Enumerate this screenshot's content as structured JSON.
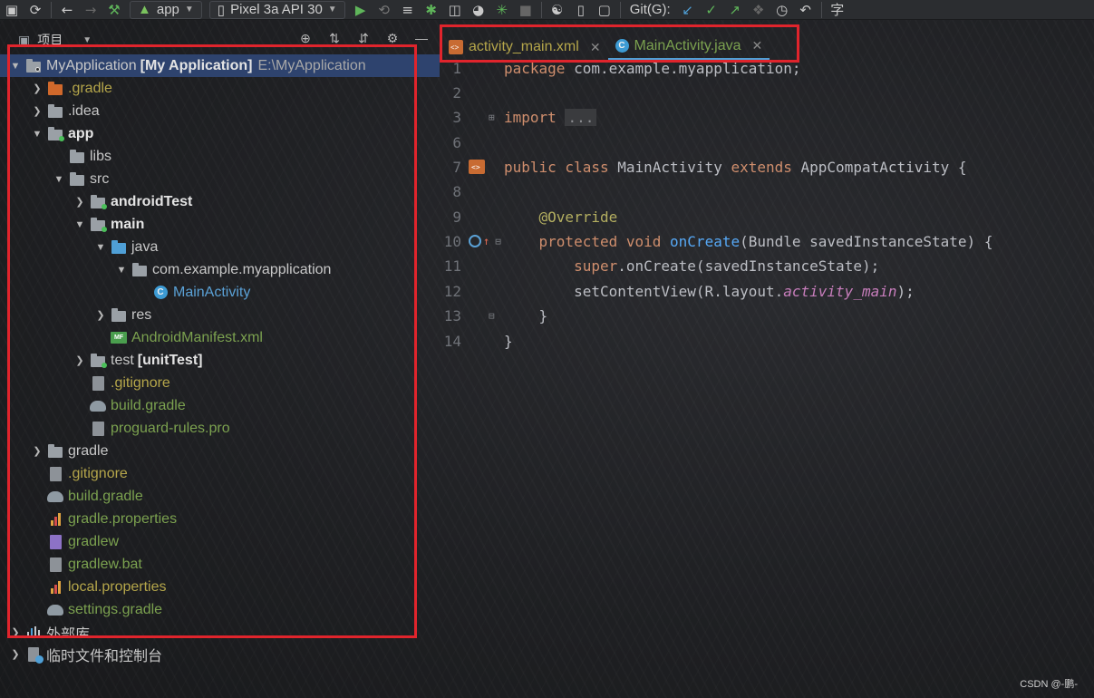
{
  "toolbar": {
    "run_config": "app",
    "device": "Pixel 3a API 30",
    "git_label": "Git(G):"
  },
  "project_panel": {
    "title": "项目",
    "tree": [
      {
        "name": "MyApplication",
        "module": "[My Application]",
        "path": "E:\\MyApplication"
      },
      {
        "label": ".gradle"
      },
      {
        "label": ".idea"
      },
      {
        "label": "app"
      },
      {
        "label": "libs"
      },
      {
        "label": "src"
      },
      {
        "label": "androidTest"
      },
      {
        "label": "main"
      },
      {
        "label": "java"
      },
      {
        "label": "com.example.myapplication"
      },
      {
        "label": "MainActivity"
      },
      {
        "label": "res"
      },
      {
        "label": "AndroidManifest.xml"
      },
      {
        "label": "test",
        "suffix": "[unitTest]"
      },
      {
        "label": ".gitignore"
      },
      {
        "label": "build.gradle"
      },
      {
        "label": "proguard-rules.pro"
      },
      {
        "label": "gradle"
      },
      {
        "label": ".gitignore"
      },
      {
        "label": "build.gradle"
      },
      {
        "label": "gradle.properties"
      },
      {
        "label": "gradlew"
      },
      {
        "label": "gradlew.bat"
      },
      {
        "label": "local.properties"
      },
      {
        "label": "settings.gradle"
      },
      {
        "label": "外部库"
      },
      {
        "label": "临时文件和控制台"
      }
    ]
  },
  "editor": {
    "tabs": [
      {
        "label": "activity_main.xml"
      },
      {
        "label": "MainActivity.java"
      }
    ],
    "lines": [
      {
        "num": "1",
        "t1": "package",
        "t2": " com.example.myapplication;"
      },
      {
        "num": "2"
      },
      {
        "num": "3",
        "t1": "import",
        "t2": "..."
      },
      {
        "num": "6"
      },
      {
        "num": "7",
        "t1": "public class",
        "t2": " MainActivity ",
        "t3": "extends",
        "t4": " AppCompatActivity {"
      },
      {
        "num": "8"
      },
      {
        "num": "9",
        "t1": "@Override"
      },
      {
        "num": "10",
        "t1": "protected void",
        "t2": "onCreate",
        "t3": "(Bundle savedInstanceState) {"
      },
      {
        "num": "11",
        "t1": "super",
        "t2": ".onCreate(savedInstanceState);"
      },
      {
        "num": "12",
        "t1": "setContentView(R.layout.",
        "t2": "activity_main",
        "t3": ");"
      },
      {
        "num": "13",
        "t1": "}"
      },
      {
        "num": "14",
        "t1": "}"
      }
    ]
  },
  "watermark": "CSDN @-鹏-",
  "colors": {
    "highlight": "#e0242c",
    "selection": "#2e436e",
    "accent": "#4f9fd6"
  }
}
